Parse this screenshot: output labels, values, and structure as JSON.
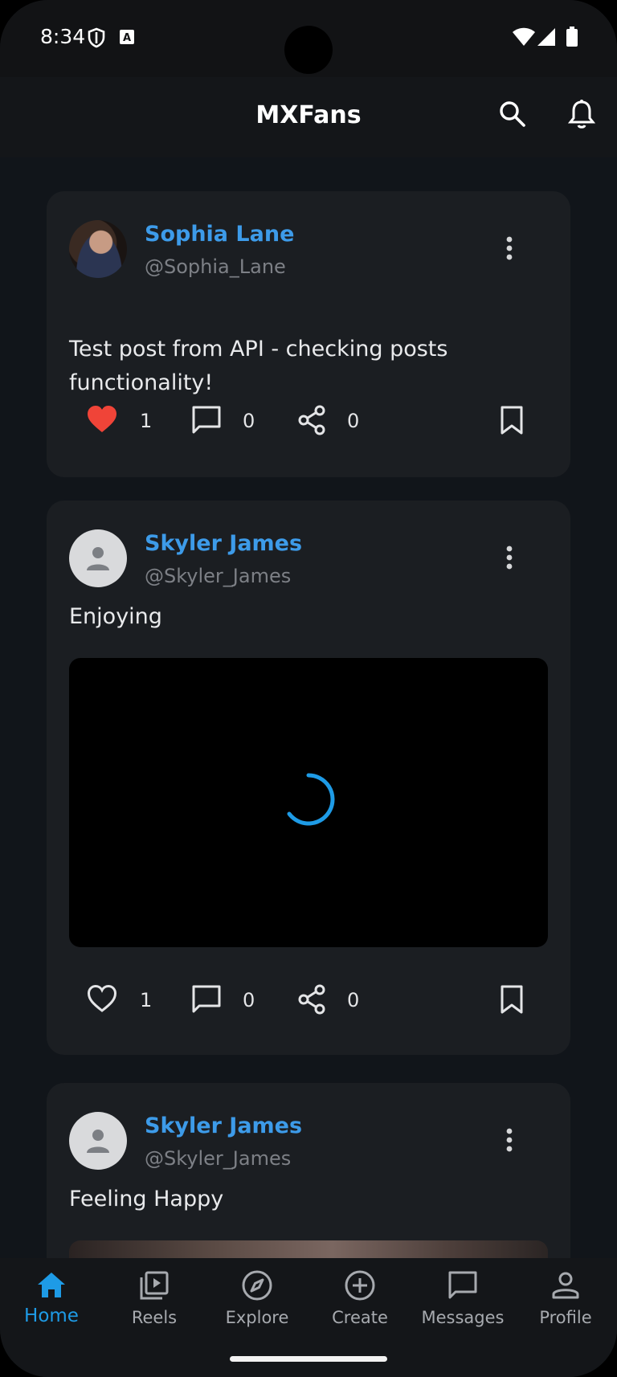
{
  "status_bar": {
    "time": "8:34"
  },
  "app_bar": {
    "title": "MXFans"
  },
  "posts": [
    {
      "name": "Sophia Lane",
      "handle": "@Sophia_Lane",
      "text": "Test post from API - checking posts functionality!",
      "liked": true,
      "likes": "1",
      "comments": "0",
      "shares": "0",
      "media": "none"
    },
    {
      "name": "Skyler James",
      "handle": "@Skyler_James",
      "text": "Enjoying",
      "liked": false,
      "likes": "1",
      "comments": "0",
      "shares": "0",
      "media": "video-loading"
    },
    {
      "name": "Skyler James",
      "handle": "@Skyler_James",
      "text": "Feeling Happy",
      "media": "image"
    }
  ],
  "bottom_nav": {
    "items": [
      {
        "label": "Home",
        "icon": "home-icon",
        "active": true
      },
      {
        "label": "Reels",
        "icon": "reels-icon",
        "active": false
      },
      {
        "label": "Explore",
        "icon": "compass-icon",
        "active": false
      },
      {
        "label": "Create",
        "icon": "add-circle-icon",
        "active": false
      },
      {
        "label": "Messages",
        "icon": "chat-bubble-icon",
        "active": false
      },
      {
        "label": "Profile",
        "icon": "person-icon",
        "active": false
      }
    ]
  },
  "colors": {
    "accent": "#1e9be6",
    "name": "#3d9be9",
    "like": "#f04438",
    "card": "#1b1e22",
    "background": "#11151a"
  }
}
